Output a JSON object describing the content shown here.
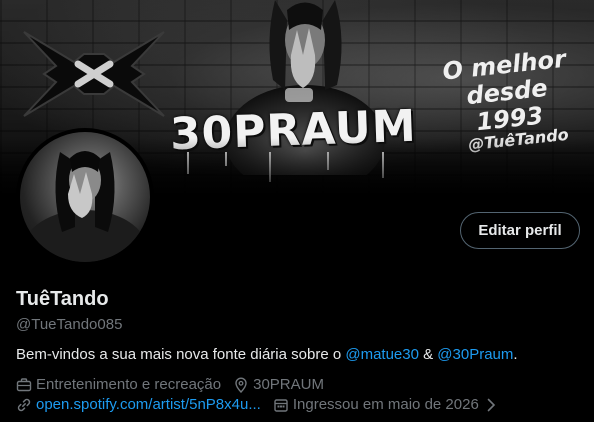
{
  "banner": {
    "brand_text": "30PRAUM",
    "slogan_line1": "O melhor",
    "slogan_line2": "desde 1993",
    "tag": "@TuêTando"
  },
  "profile": {
    "edit_button_label": "Editar perfil",
    "display_name": "TuêTando",
    "handle": "@TueTando085",
    "bio": {
      "prefix": "Bem-vindos a sua mais nova fonte diária sobre o ",
      "mention1": "@matue30",
      "separator": " & ",
      "mention2": "@30Praum",
      "suffix": "."
    },
    "category": "Entretenimento e recreação",
    "location": "30PRAUM",
    "website": "open.spotify.com/artist/5nP8x4u...",
    "joined": "Ingressou em maio de 2026"
  },
  "icons": {
    "category": "briefcase-icon",
    "location": "location-pin-icon",
    "website": "link-icon",
    "joined": "calendar-icon",
    "more": "chevron-right-icon"
  },
  "colors": {
    "background": "#000000",
    "text": "#e7e9ea",
    "secondary": "#71767b",
    "link": "#1d9bf0",
    "button_border": "#536471"
  }
}
